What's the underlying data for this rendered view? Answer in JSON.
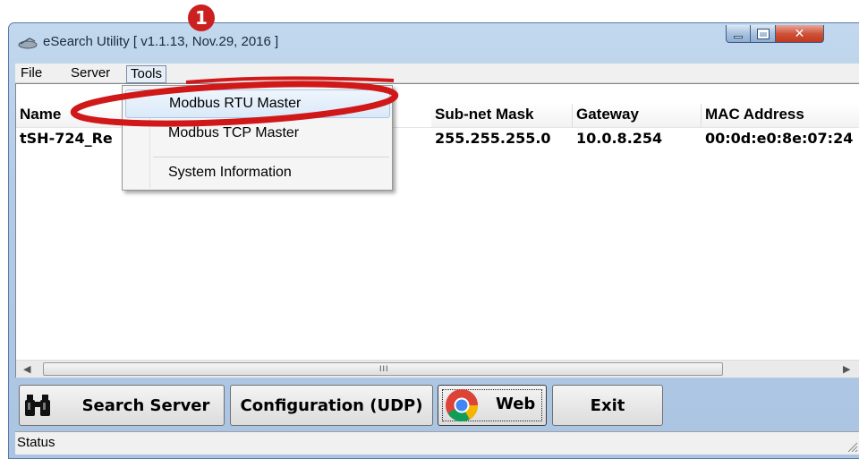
{
  "window": {
    "title": "eSearch Utility [ v1.1.13, Nov.29, 2016 ]"
  },
  "menubar": {
    "file": "File",
    "server": "Server",
    "tools": "Tools"
  },
  "tools_menu": {
    "items": [
      "Modbus RTU Master",
      "Modbus TCP Master",
      "System Information"
    ]
  },
  "table": {
    "columns": [
      "Name",
      "Sub-net Mask",
      "Gateway",
      "MAC Address"
    ],
    "rows": [
      {
        "name": "tSH-724_Re",
        "subnet": "255.255.255.0",
        "gateway": "10.0.8.254",
        "mac": "00:0d:e0:8e:07:24"
      }
    ]
  },
  "scrollbar": {
    "grip": "III"
  },
  "buttons": {
    "search": "Search Server",
    "config": "Configuration (UDP)",
    "web": "Web",
    "exit": "Exit"
  },
  "status": {
    "text": "Status"
  },
  "annotation": {
    "step": "1"
  },
  "icons": {
    "app": "esearch-app-icon",
    "binoculars": "binoculars-icon",
    "chrome": "chrome-icon"
  },
  "colors": {
    "annotation_red": "#d01818",
    "highlight": "#dbe9f8"
  }
}
